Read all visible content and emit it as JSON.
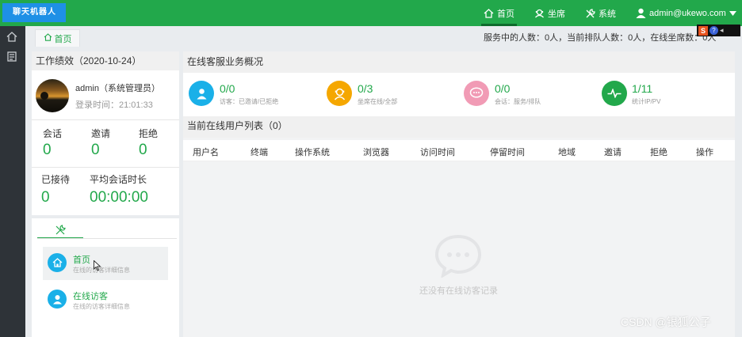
{
  "header": {
    "logo_text": "聊天机器人",
    "nav": [
      {
        "label": "首页",
        "icon": "home-icon"
      },
      {
        "label": "坐席",
        "icon": "headset-icon"
      },
      {
        "label": "系统",
        "icon": "tools-icon"
      }
    ],
    "user": "admin@ukewo.com"
  },
  "tabs": {
    "home": "首页"
  },
  "status_line": "服务中的人数：0人，当前排队人数：0人，在线坐席数：0人",
  "tray": {
    "s": "S",
    "q": "?"
  },
  "performance": {
    "title": "工作绩效（2020-10-24）",
    "user_name": "admin（系统管理员）",
    "login_time": "登录时间：21:01:33",
    "metrics": [
      {
        "label": "会话",
        "value": "0"
      },
      {
        "label": "邀请",
        "value": "0"
      },
      {
        "label": "拒绝",
        "value": "0"
      }
    ],
    "waited_label": "已接待",
    "waited_value": "0",
    "avg_label": "平均会话时长",
    "avg_value": "00:00:00"
  },
  "menu": {
    "items": [
      {
        "title": "首页",
        "sub": "在线的访客详细信息"
      },
      {
        "title": "在线访客",
        "sub": "在线的访客详细信息"
      }
    ]
  },
  "overview": {
    "title": "在线客服业务概况",
    "cards": [
      {
        "value": "0/0",
        "sub": "访客：已邀请/已拒绝",
        "color": "#1ab0e8",
        "icon": "visitor-icon"
      },
      {
        "value": "0/3",
        "sub": "坐席在线/全部",
        "color": "#f5a700",
        "icon": "agent-icon"
      },
      {
        "value": "0/0",
        "sub": "会话：服务/排队",
        "color": "#f19bb5",
        "icon": "chat-icon"
      },
      {
        "value": "1/11",
        "sub": "统计IP/PV",
        "color": "#22a84b",
        "icon": "pulse-icon"
      }
    ]
  },
  "visitors": {
    "title": "当前在线用户列表（0）",
    "columns": [
      "用户名",
      "终端",
      "操作系统",
      "浏览器",
      "访问时间",
      "停留时间",
      "地域",
      "邀请",
      "拒绝",
      "操作"
    ],
    "empty_text": "还没有在线访客记录"
  },
  "watermark": "CSDN @银狐公子",
  "colors": {
    "primary": "#22a84b",
    "logo_bg": "#1e90e6",
    "sidebar": "#2e3338"
  }
}
